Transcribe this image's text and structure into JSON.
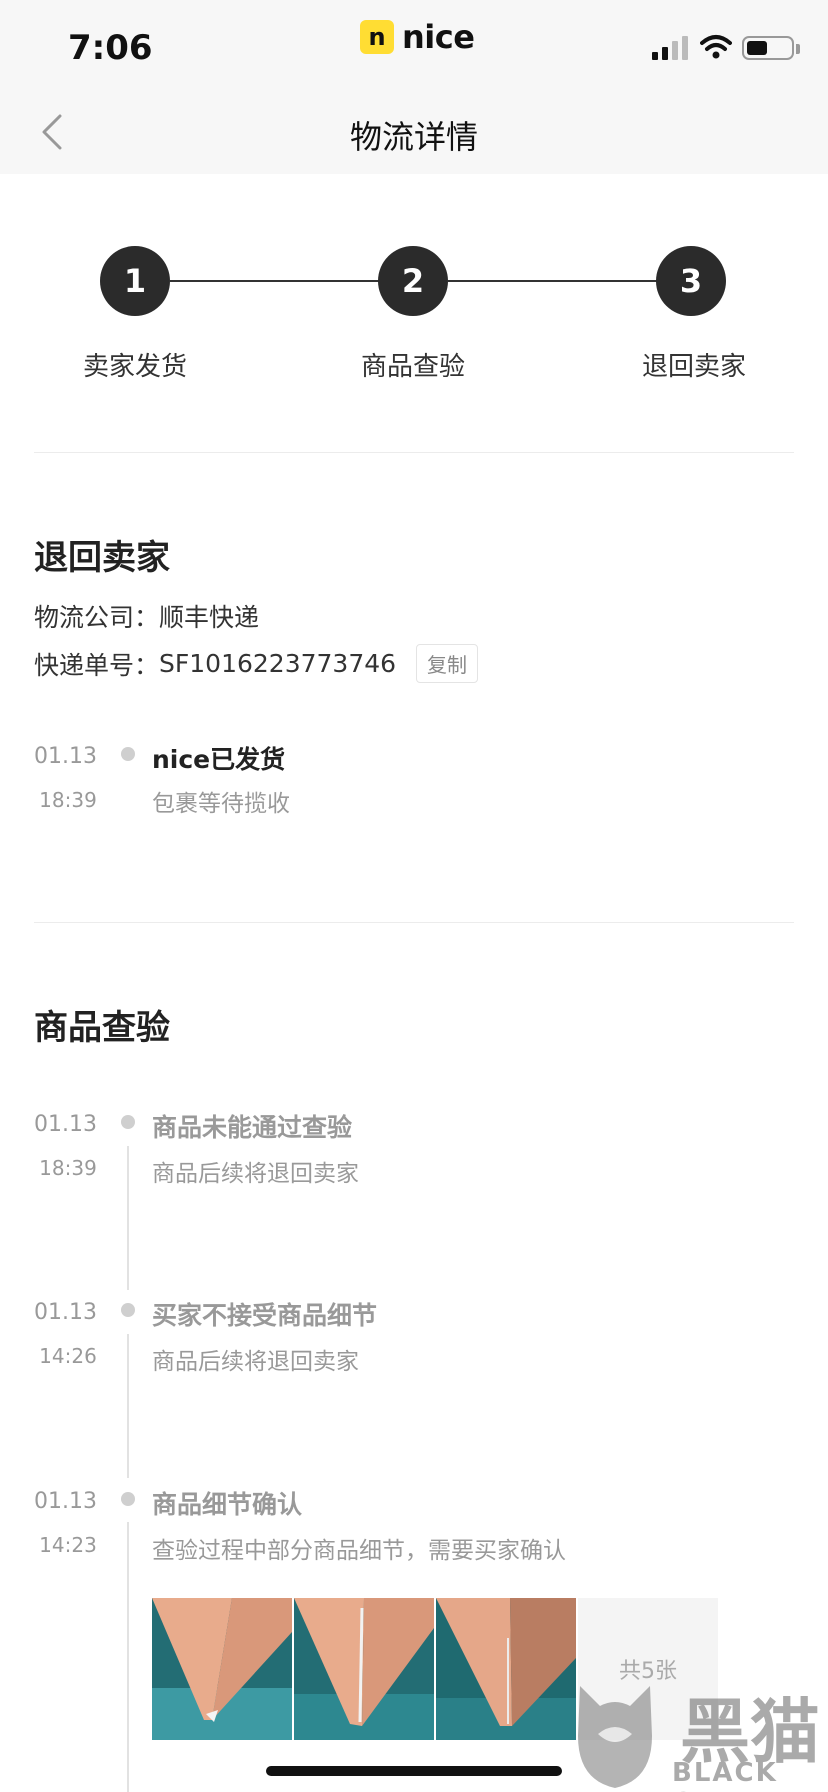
{
  "status_bar": {
    "time": "7:06",
    "logo_letter": "n",
    "logo_text": "nice"
  },
  "nav": {
    "title": "物流详情"
  },
  "stepper": {
    "steps": [
      {
        "number": "1",
        "label": "卖家发货"
      },
      {
        "number": "2",
        "label": "商品查验"
      },
      {
        "number": "3",
        "label": "退回卖家"
      }
    ]
  },
  "return_section": {
    "title": "退回卖家",
    "company_label": "物流公司：",
    "company_value": "顺丰快递",
    "tracking_label": "快递单号：",
    "tracking_value": "SF1016223773746",
    "copy_label": "复制",
    "events": [
      {
        "date": "01.13",
        "time": "18:39",
        "title": "nice已发货",
        "desc": "包裹等待揽收"
      }
    ]
  },
  "inspection_section": {
    "title": "商品查验",
    "events": [
      {
        "date": "01.13",
        "time": "18:39",
        "title": "商品未能通过查验",
        "desc": "商品后续将退回卖家"
      },
      {
        "date": "01.13",
        "time": "14:26",
        "title": "买家不接受商品细节",
        "desc": "商品后续将退回卖家"
      },
      {
        "date": "01.13",
        "time": "14:23",
        "title": "商品细节确认",
        "desc": "查验过程中部分商品细节，需要买家确认"
      }
    ],
    "photos_more_label": "共5张"
  },
  "watermark": {
    "cn": "黑猫",
    "en": "BLACK CAT"
  },
  "colors": {
    "logo_yellow": "#ffdd33",
    "step_dark": "#2b2b2b",
    "muted_text": "#999999"
  }
}
